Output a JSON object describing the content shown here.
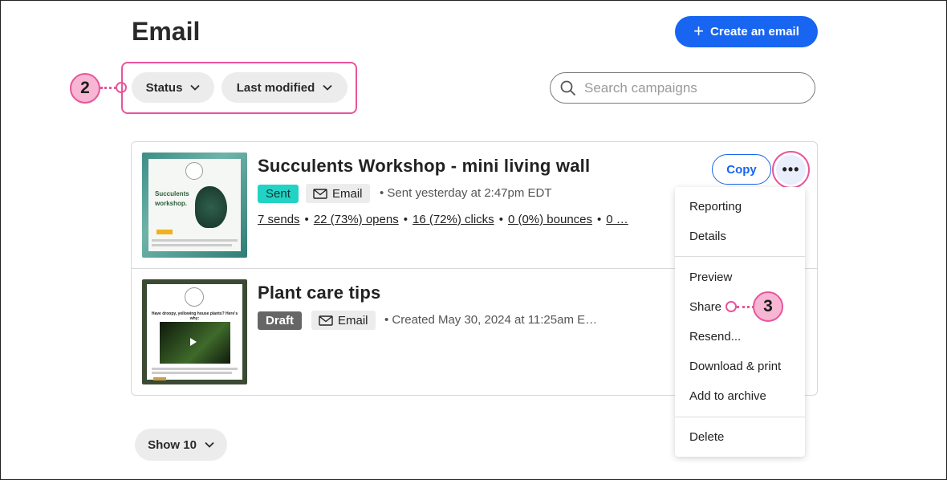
{
  "header": {
    "title": "Email",
    "create_label": "Create an email"
  },
  "filters": {
    "status_label": "Status",
    "sort_label": "Last modified"
  },
  "search": {
    "placeholder": "Search campaigns"
  },
  "callouts": {
    "filters_number": "2",
    "share_number": "3"
  },
  "campaigns": [
    {
      "title": "Succulents Workshop - mini living wall",
      "status": "Sent",
      "type": "Email",
      "meta": "Sent yesterday at 2:47pm EDT",
      "stats": {
        "sends": "7 sends",
        "opens": "22 (73%) opens",
        "clicks": "16 (72%) clicks",
        "bounces": "0 (0%) bounces",
        "more": "0 …"
      },
      "copy_label": "Copy",
      "thumb_heading": "Succulents workshop."
    },
    {
      "title": "Plant care tips",
      "status": "Draft",
      "type": "Email",
      "meta": "Created May 30, 2024 at 11:25am E…",
      "thumb_heading": "Have droopy, yellowing house plants? Here's why:"
    }
  ],
  "more_menu": {
    "button_label": "•••",
    "items": [
      "Reporting",
      "Details",
      "Preview",
      "Share",
      "Resend...",
      "Download & print",
      "Add to archive",
      "Delete"
    ]
  },
  "pagination": {
    "show_label": "Show 10"
  },
  "colors": {
    "accent_blue": "#1765f0",
    "callout_pink": "#e8559a",
    "sent_badge": "#22d3c5",
    "draft_badge": "#666666"
  }
}
